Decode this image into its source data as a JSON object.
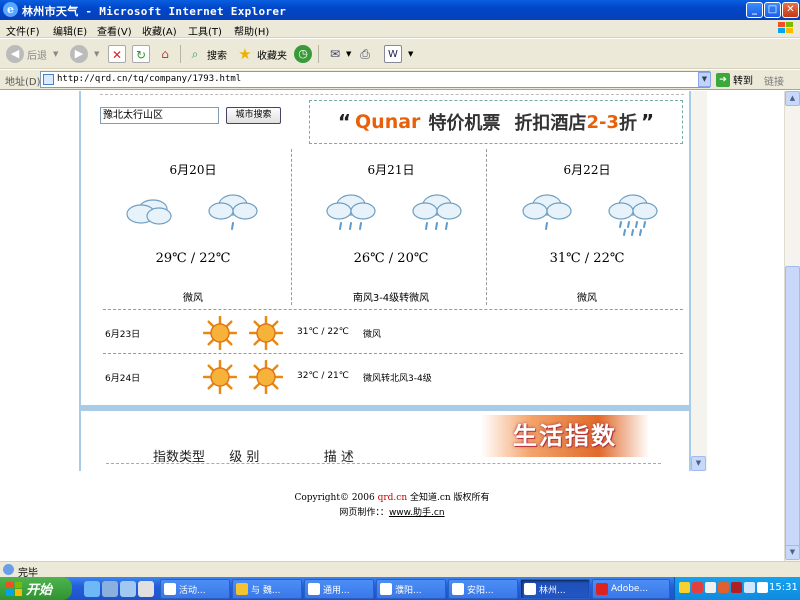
{
  "window": {
    "title": "林州市天气 - Microsoft Internet Explorer",
    "buttons": {
      "minimize": "_",
      "maximize": "□",
      "close": "✕"
    }
  },
  "menu": [
    "文件(F)",
    "编辑(E)",
    "查看(V)",
    "收藏(A)",
    "工具(T)",
    "帮助(H)"
  ],
  "toolbar": {
    "back": "后退",
    "search": "搜索",
    "favorites": "收藏夹"
  },
  "address": {
    "label": "地址(D)",
    "url": "http://qrd.cn/tq/company/1793.html",
    "go": "转到",
    "links": "链接"
  },
  "search": {
    "value": "豫北太行山区",
    "button": "城市搜索"
  },
  "ad": {
    "brand": "Qunar",
    "text1": "特价机票",
    "text2": "折扣酒店",
    "num": "2-3",
    "text3": "折"
  },
  "forecast": [
    {
      "date": "6月20日",
      "temp": "29℃ / 22℃",
      "wind": "微风",
      "icons": [
        "cloudy-icon",
        "light-rain-icon"
      ]
    },
    {
      "date": "6月21日",
      "temp": "26℃ / 20℃",
      "wind": "南风3-4级转微风",
      "icons": [
        "rain-icon",
        "rain-icon"
      ]
    },
    {
      "date": "6月22日",
      "temp": "31℃ / 22℃",
      "wind": "微风",
      "icons": [
        "light-rain-icon",
        "heavy-rain-icon"
      ]
    }
  ],
  "extended": [
    {
      "date": "6月23日",
      "temp": "31℃ / 22℃",
      "wind": "微风",
      "icons": [
        "sunny-icon",
        "sunny-icon"
      ]
    },
    {
      "date": "6月24日",
      "temp": "32℃ / 21℃",
      "wind": "微风转北风3-4级",
      "icons": [
        "sunny-icon",
        "sunny-icon"
      ]
    }
  ],
  "life": {
    "badge": "生活指数",
    "col_type": "指数类型",
    "col_level": "级 别",
    "col_desc": "描 述"
  },
  "footer": {
    "copyright_prefix": "Copyright© 2006 ",
    "site": "qrd.cn",
    "copyright_suffix": " 全知道.cn 版权所有",
    "made_by_label": "网页制作：：",
    "made_by_link": "www.助手.cn"
  },
  "status": {
    "text": "完毕"
  },
  "taskbar": {
    "start": "开始",
    "tasks": [
      "活动...",
      "与 魏...",
      "通用...",
      "濮阳...",
      "安阳...",
      "林州...",
      "Adobe..."
    ],
    "clock": "15:31"
  },
  "colors": {
    "title_bar": "#0046c8",
    "chrome": "#ece9d8",
    "frame_blue": "#a8cce8",
    "accent_orange": "#e8600a",
    "taskbar": "#245edb"
  }
}
